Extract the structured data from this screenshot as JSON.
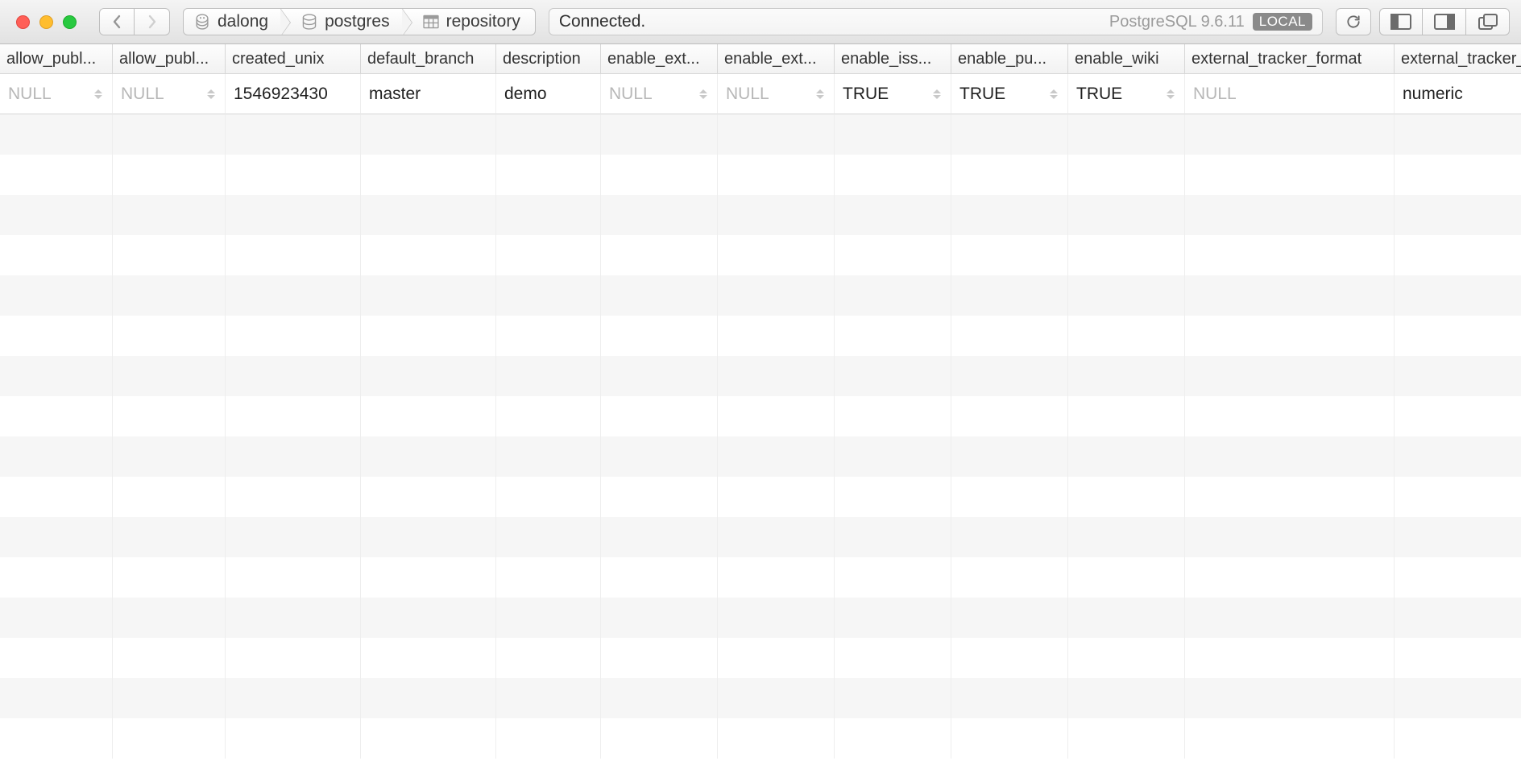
{
  "toolbar": {
    "status_text": "Connected.",
    "db_version_label": "PostgreSQL 9.6.11",
    "local_badge": "LOCAL"
  },
  "breadcrumb": [
    {
      "label": "dalong",
      "icon": "server-icon"
    },
    {
      "label": "postgres",
      "icon": "database-icon"
    },
    {
      "label": "repository",
      "icon": "table-icon"
    }
  ],
  "table": {
    "columns": [
      {
        "label": "allow_publ..."
      },
      {
        "label": "allow_publ..."
      },
      {
        "label": "created_unix"
      },
      {
        "label": "default_branch"
      },
      {
        "label": "description"
      },
      {
        "label": "enable_ext..."
      },
      {
        "label": "enable_ext..."
      },
      {
        "label": "enable_iss..."
      },
      {
        "label": "enable_pu..."
      },
      {
        "label": "enable_wiki"
      },
      {
        "label": "external_tracker_format"
      },
      {
        "label": "external_tracker_s"
      }
    ],
    "rows": [
      {
        "cells": [
          {
            "value": "NULL",
            "null": true,
            "sort": true
          },
          {
            "value": "NULL",
            "null": true,
            "sort": true
          },
          {
            "value": "1546923430",
            "null": false,
            "sort": false
          },
          {
            "value": "master",
            "null": false,
            "sort": false
          },
          {
            "value": "demo",
            "null": false,
            "sort": false
          },
          {
            "value": "NULL",
            "null": true,
            "sort": true
          },
          {
            "value": "NULL",
            "null": true,
            "sort": true
          },
          {
            "value": "TRUE",
            "null": false,
            "sort": true
          },
          {
            "value": "TRUE",
            "null": false,
            "sort": true
          },
          {
            "value": "TRUE",
            "null": false,
            "sort": true
          },
          {
            "value": "NULL",
            "null": true,
            "sort": false
          },
          {
            "value": "numeric",
            "null": false,
            "sort": false
          }
        ]
      }
    ]
  }
}
